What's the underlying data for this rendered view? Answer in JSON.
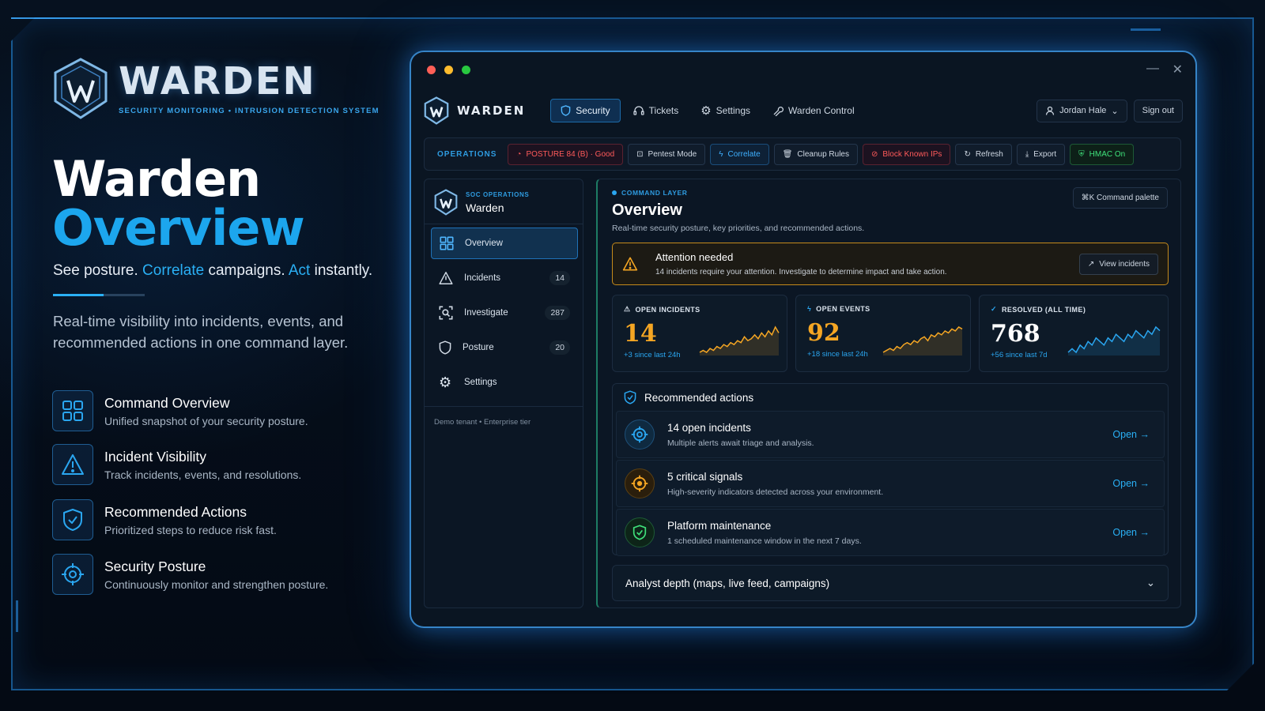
{
  "brand": {
    "name": "WARDEN",
    "tagline": "SECURITY MONITORING  •  INTRUSION DETECTION SYSTEM"
  },
  "hero": {
    "title_line1": "Warden",
    "title_line2": "Overview",
    "tagline_part1": "See posture. ",
    "tagline_hl1": "Correlate",
    "tagline_part2": " campaigns. ",
    "tagline_hl2": "Act",
    "tagline_part3": " instantly.",
    "description": "Real-time visibility into incidents, events, and recommended actions in one command layer."
  },
  "features": [
    {
      "title": "Command Overview",
      "desc": "Unified snapshot of your security posture.",
      "icon": "grid-icon"
    },
    {
      "title": "Incident Visibility",
      "desc": "Track incidents, events, and resolutions.",
      "icon": "warning-icon"
    },
    {
      "title": "Recommended Actions",
      "desc": "Prioritized steps to reduce risk fast.",
      "icon": "shield-check-icon"
    },
    {
      "title": "Security Posture",
      "desc": "Continuously monitor and strengthen posture.",
      "icon": "target-icon"
    }
  ],
  "app": {
    "name": "WARDEN",
    "nav": [
      {
        "label": "Security",
        "icon": "shield-icon",
        "active": true
      },
      {
        "label": "Tickets",
        "icon": "headset-icon"
      },
      {
        "label": "Settings",
        "icon": "gear-icon"
      },
      {
        "label": "Warden Control",
        "icon": "wrench-icon"
      }
    ],
    "user": "Jordan Hale",
    "sign_out": "Sign out",
    "ops": {
      "label": "OPERATIONS",
      "posture": "POSTURE  84 (B) · Good",
      "pentest": "Pentest Mode",
      "correlate": "Correlate",
      "cleanup": "Cleanup Rules",
      "block": "Block Known IPs",
      "refresh": "Refresh",
      "export": "Export",
      "hmac": "HMAC On"
    },
    "sidebar": {
      "sub": "SOC OPERATIONS",
      "title": "Warden",
      "items": [
        {
          "label": "Overview",
          "count": ""
        },
        {
          "label": "Incidents",
          "count": "14"
        },
        {
          "label": "Investigate",
          "count": "287"
        },
        {
          "label": "Posture",
          "count": "20"
        },
        {
          "label": "Settings",
          "count": ""
        }
      ],
      "footer": "Demo tenant  •  Enterprise tier"
    },
    "main": {
      "crumb": "COMMAND LAYER",
      "title": "Overview",
      "subtitle": "Real-time security posture, key priorities, and recommended actions.",
      "command_palette": "⌘K  Command palette",
      "alert": {
        "title": "Attention needed",
        "desc": "14 incidents require your attention. Investigate to determine impact and take action.",
        "button": "View incidents"
      },
      "stats": [
        {
          "label": "OPEN INCIDENTS",
          "value": "14",
          "delta": "+3 since last 24h",
          "color": "#f5a623",
          "trend": [
            4,
            5,
            4,
            6,
            5,
            7,
            6,
            8,
            7,
            9,
            8,
            10,
            9,
            12,
            10,
            11,
            13,
            11,
            14,
            12,
            15,
            13,
            17,
            14
          ]
        },
        {
          "label": "OPEN EVENTS",
          "value": "92",
          "delta": "+18 since last 24h",
          "color": "#f5a623",
          "trend": [
            3,
            4,
            5,
            4,
            6,
            5,
            7,
            8,
            7,
            9,
            8,
            10,
            11,
            9,
            12,
            11,
            13,
            12,
            14,
            13,
            15,
            14,
            16,
            15
          ]
        },
        {
          "label": "RESOLVED (ALL TIME)",
          "value": "768",
          "delta": "+56 since last 7d",
          "color": "#ffffff",
          "trend": [
            5,
            6,
            5,
            7,
            6,
            8,
            7,
            9,
            8,
            7,
            9,
            8,
            10,
            9,
            8,
            10,
            9,
            11,
            10,
            9,
            11,
            10,
            12,
            11
          ]
        }
      ],
      "recommended": {
        "title": "Recommended actions",
        "open_label": "Open",
        "items": [
          {
            "title": "14 open incidents",
            "desc": "Multiple alerts await triage and analysis.",
            "color": "#2aa6f0"
          },
          {
            "title": "5 critical signals",
            "desc": "High-severity indicators detected across your environment.",
            "color": "#f5a623"
          },
          {
            "title": "Platform maintenance",
            "desc": "1 scheduled maintenance window in the next 7 days.",
            "color": "#3fe07a"
          }
        ]
      },
      "analyst": "Analyst depth (maps, live feed, campaigns)"
    }
  }
}
